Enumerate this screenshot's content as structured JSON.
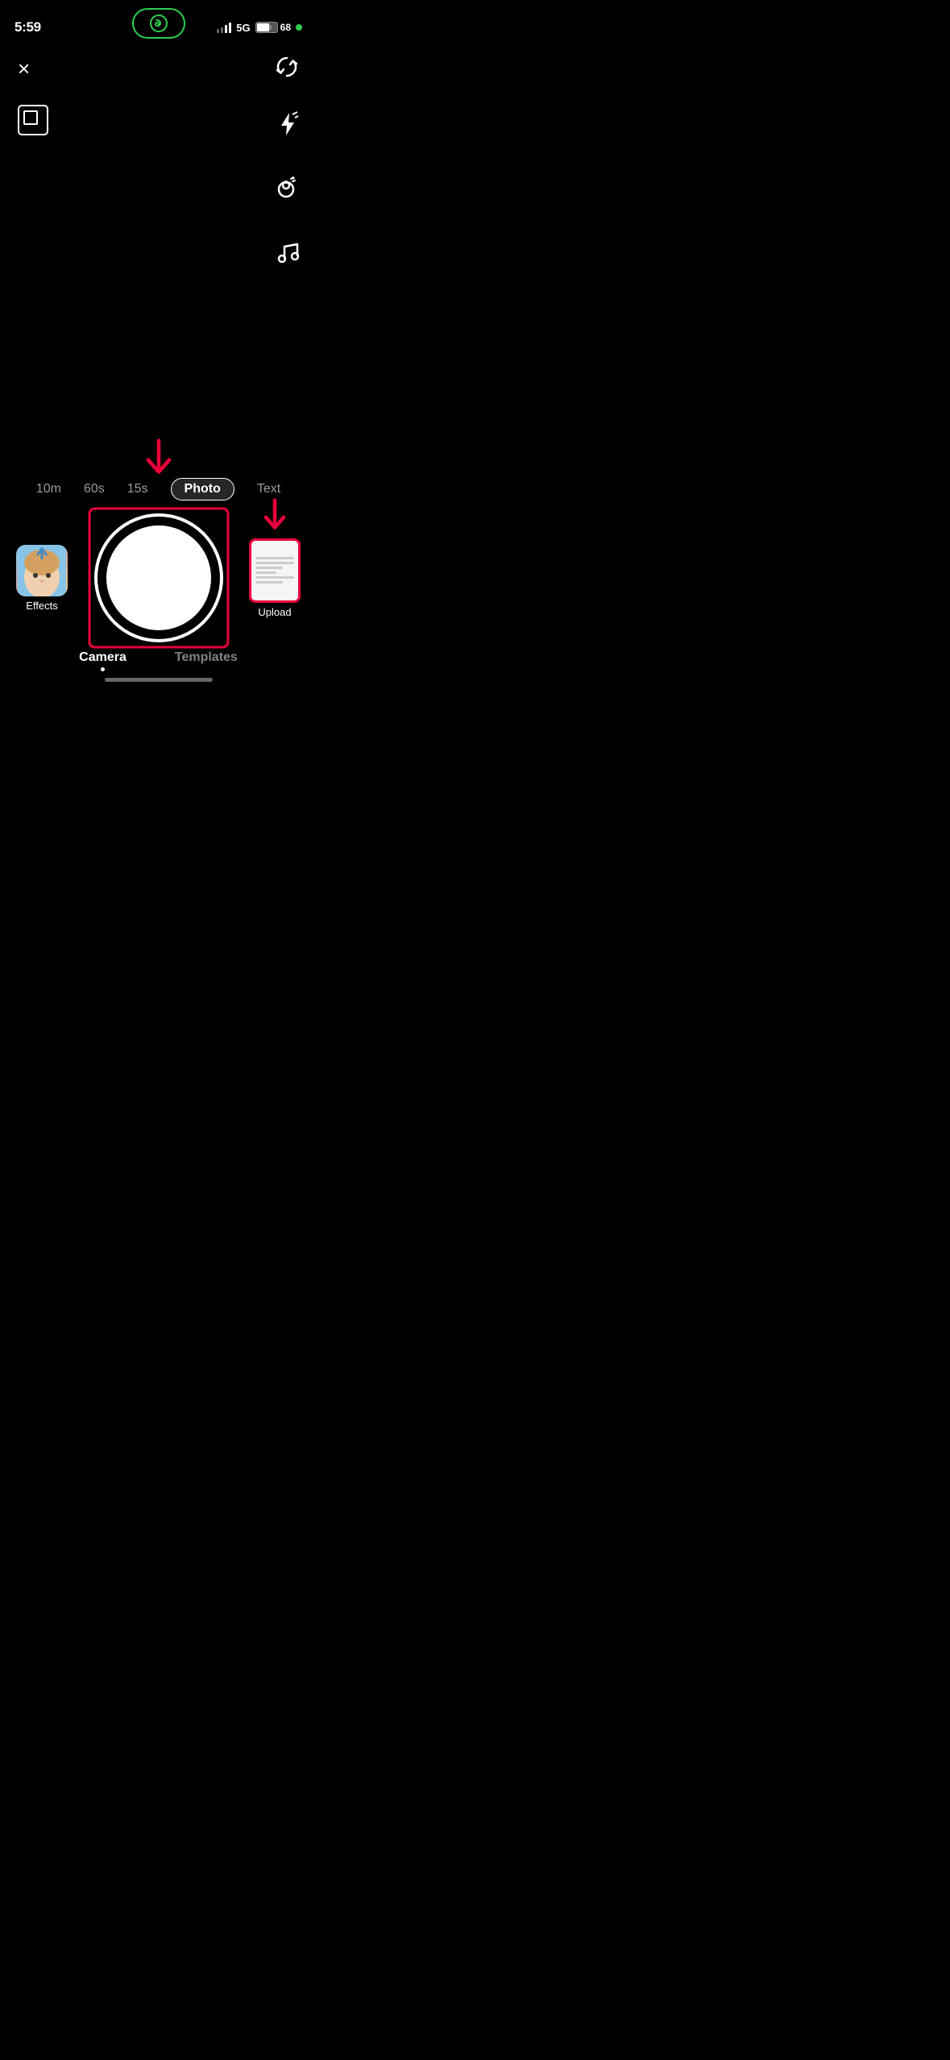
{
  "status": {
    "time": "5:59",
    "network": "5G",
    "battery_percent": "68",
    "battery_level": 0.68
  },
  "header": {
    "close_label": "×",
    "flip_symbol": "↻",
    "flash_symbol": "⚡",
    "beauty_symbol": "✨",
    "music_symbol": "♪"
  },
  "duration_modes": [
    {
      "label": "10m",
      "active": false
    },
    {
      "label": "60s",
      "active": false
    },
    {
      "label": "15s",
      "active": false
    },
    {
      "label": "Photo",
      "active": true
    },
    {
      "label": "Text",
      "active": false
    }
  ],
  "effects": {
    "label": "Effects",
    "thumbnail_emoji": "🧑"
  },
  "upload": {
    "label": "Upload"
  },
  "tabs": [
    {
      "label": "Camera",
      "active": true
    },
    {
      "label": "Templates",
      "active": false
    }
  ],
  "arrows": {
    "main_arrow": "↓",
    "upload_arrow": "↓"
  }
}
